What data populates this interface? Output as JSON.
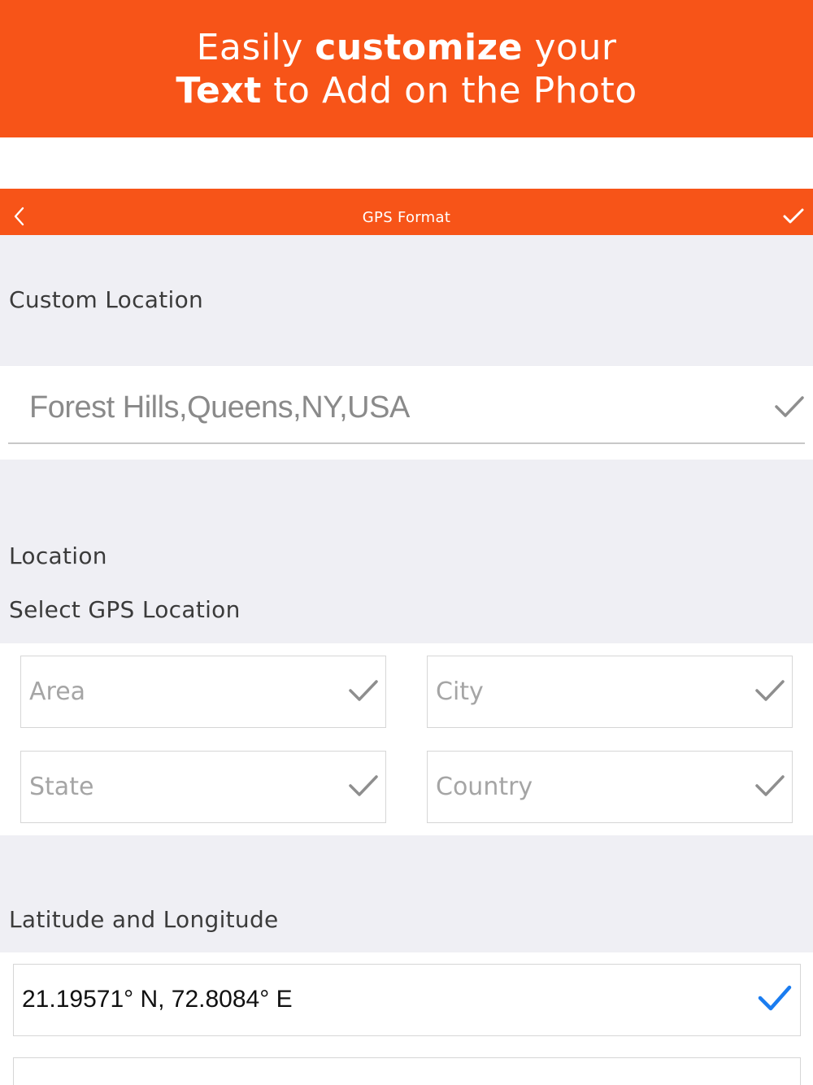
{
  "promo": {
    "line1_a": "Easily ",
    "line1_b": "customize",
    "line1_c": " your",
    "line2_a": "Text",
    "line2_b": " to Add on the Photo"
  },
  "navbar": {
    "title": "GPS Format"
  },
  "custom_location": {
    "label": "Custom Location",
    "value": "Forest Hills,Queens,NY,USA"
  },
  "location": {
    "label": "Location",
    "sublabel": "Select GPS Location",
    "fields": [
      "Area",
      "City",
      "State",
      "Country"
    ]
  },
  "latlong": {
    "label": "Latitude and Longitude",
    "value": "21.19571° N, 72.8084° E"
  },
  "colors": {
    "accent": "#f75418",
    "check_gray": "#8e8e8e",
    "check_blue": "#1a7cf0"
  }
}
